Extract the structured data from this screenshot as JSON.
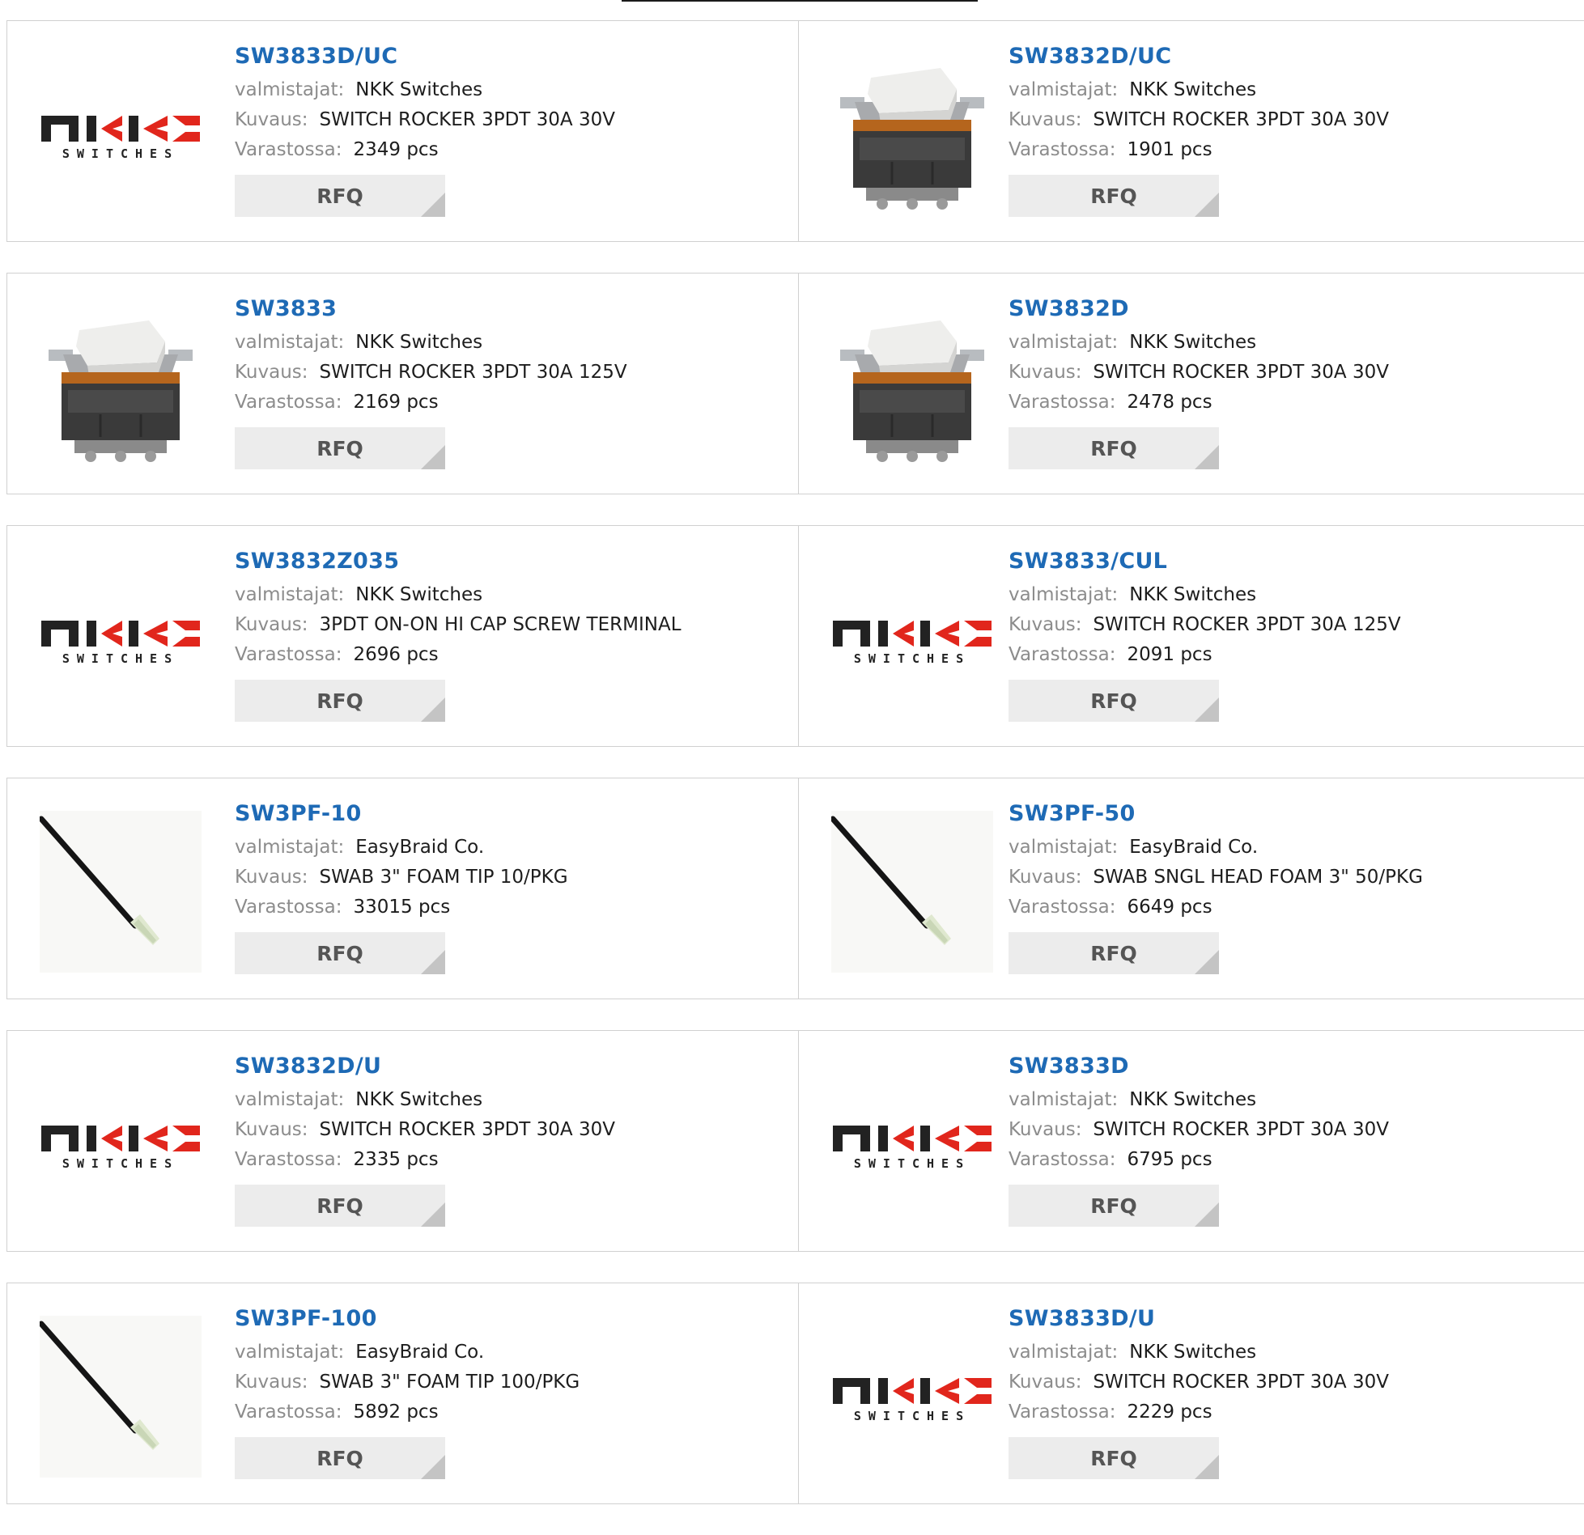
{
  "labels": {
    "manufacturer": "valmistajat:",
    "description": "Kuvaus:",
    "stock": "Varastossa:",
    "rfq": "RFQ"
  },
  "products": [
    {
      "name": "SW3833D/UC",
      "manufacturer": "NKK Switches",
      "description": "SWITCH ROCKER 3PDT 30A 30V",
      "stock": "2349 pcs",
      "image": "nkk-logo"
    },
    {
      "name": "SW3832D/UC",
      "manufacturer": "NKK Switches",
      "description": "SWITCH ROCKER 3PDT 30A 30V",
      "stock": "1901 pcs",
      "image": "rocker-switch"
    },
    {
      "name": "SW3833",
      "manufacturer": "NKK Switches",
      "description": "SWITCH ROCKER 3PDT 30A 125V",
      "stock": "2169 pcs",
      "image": "rocker-switch"
    },
    {
      "name": "SW3832D",
      "manufacturer": "NKK Switches",
      "description": "SWITCH ROCKER 3PDT 30A 30V",
      "stock": "2478 pcs",
      "image": "rocker-switch"
    },
    {
      "name": "SW3832Z035",
      "manufacturer": "NKK Switches",
      "description": "3PDT ON-ON HI CAP SCREW TERMINAL",
      "stock": "2696 pcs",
      "image": "nkk-logo"
    },
    {
      "name": "SW3833/CUL",
      "manufacturer": "NKK Switches",
      "description": "SWITCH ROCKER 3PDT 30A 125V",
      "stock": "2091 pcs",
      "image": "nkk-logo"
    },
    {
      "name": "SW3PF-10",
      "manufacturer": "EasyBraid Co.",
      "description": "SWAB 3\" FOAM TIP 10/PKG",
      "stock": "33015 pcs",
      "image": "swab"
    },
    {
      "name": "SW3PF-50",
      "manufacturer": "EasyBraid Co.",
      "description": "SWAB SNGL HEAD FOAM 3\" 50/PKG",
      "stock": "6649 pcs",
      "image": "swab"
    },
    {
      "name": "SW3832D/U",
      "manufacturer": "NKK Switches",
      "description": "SWITCH ROCKER 3PDT 30A 30V",
      "stock": "2335 pcs",
      "image": "nkk-logo"
    },
    {
      "name": "SW3833D",
      "manufacturer": "NKK Switches",
      "description": "SWITCH ROCKER 3PDT 30A 30V",
      "stock": "6795 pcs",
      "image": "nkk-logo"
    },
    {
      "name": "SW3PF-100",
      "manufacturer": "EasyBraid Co.",
      "description": "SWAB 3\" FOAM TIP 100/PKG",
      "stock": "5892 pcs",
      "image": "swab"
    },
    {
      "name": "SW3833D/U",
      "manufacturer": "NKK Switches",
      "description": "SWITCH ROCKER 3PDT 30A 30V",
      "stock": "2229 pcs",
      "image": "nkk-logo"
    }
  ],
  "colors": {
    "link": "#1e6ab5",
    "label": "#8c8c8c",
    "button_bg": "#ececec",
    "button_text": "#555555",
    "border": "#d0d0d0"
  }
}
